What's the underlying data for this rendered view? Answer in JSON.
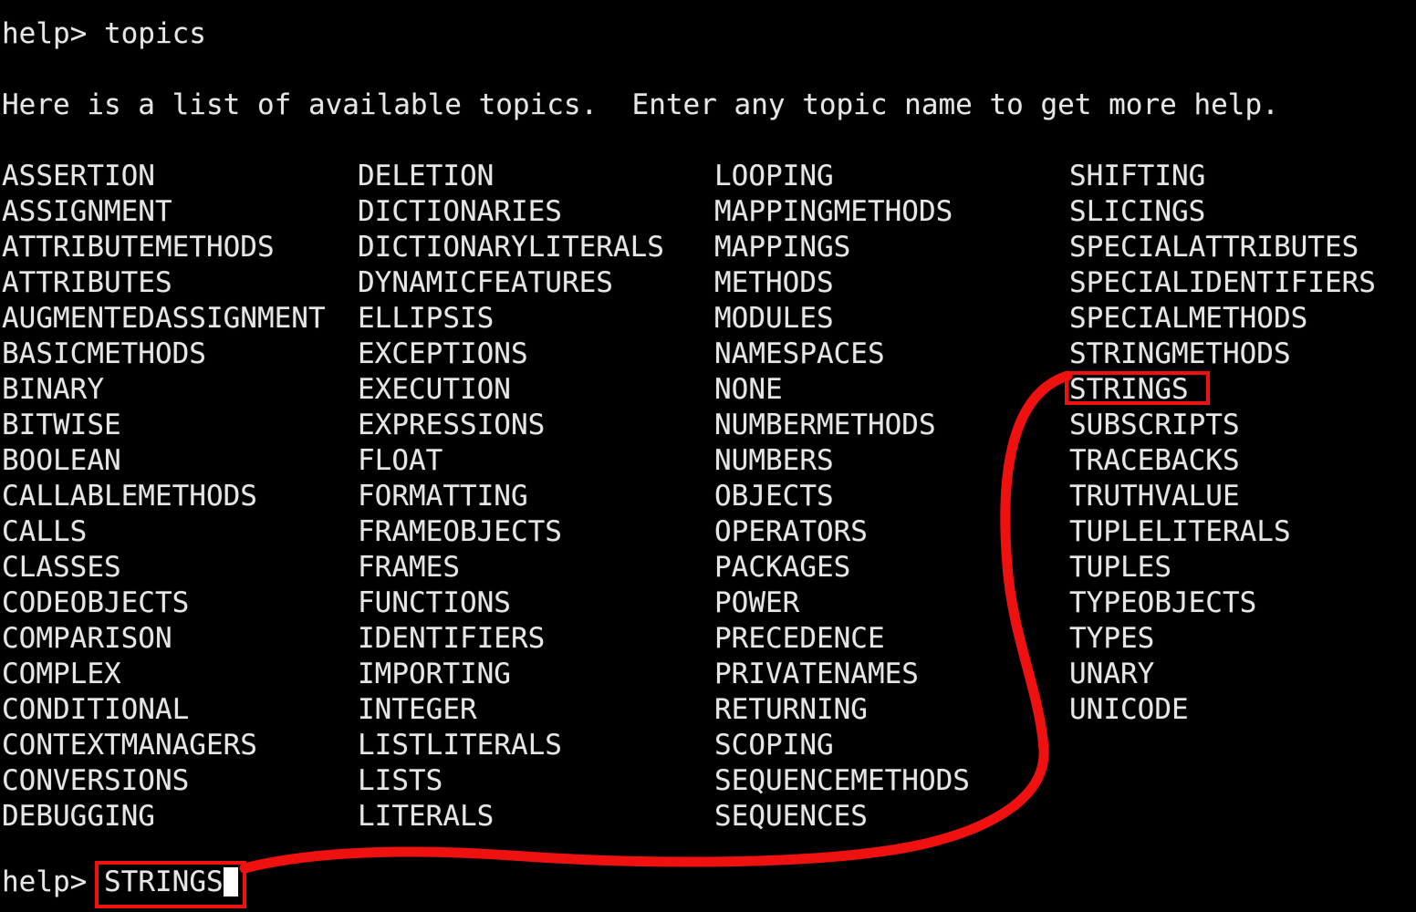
{
  "terminal": {
    "background_color": "#000000",
    "text_color": "#e6e6e6",
    "annotation_color": "#ef1010",
    "prompt_top": "help> topics",
    "intro_text": "Here is a list of available topics.  Enter any topic name to get more help.",
    "prompt_bottom_label": "help>",
    "entered_command": "STRINGS"
  },
  "topics": {
    "columns": [
      [
        "ASSERTION",
        "ASSIGNMENT",
        "ATTRIBUTEMETHODS",
        "ATTRIBUTES",
        "AUGMENTEDASSIGNMENT",
        "BASICMETHODS",
        "BINARY",
        "BITWISE",
        "BOOLEAN",
        "CALLABLEMETHODS",
        "CALLS",
        "CLASSES",
        "CODEOBJECTS",
        "COMPARISON",
        "COMPLEX",
        "CONDITIONAL",
        "CONTEXTMANAGERS",
        "CONVERSIONS",
        "DEBUGGING"
      ],
      [
        "DELETION",
        "DICTIONARIES",
        "DICTIONARYLITERALS",
        "DYNAMICFEATURES",
        "ELLIPSIS",
        "EXCEPTIONS",
        "EXECUTION",
        "EXPRESSIONS",
        "FLOAT",
        "FORMATTING",
        "FRAMEOBJECTS",
        "FRAMES",
        "FUNCTIONS",
        "IDENTIFIERS",
        "IMPORTING",
        "INTEGER",
        "LISTLITERALS",
        "LISTS",
        "LITERALS"
      ],
      [
        "LOOPING",
        "MAPPINGMETHODS",
        "MAPPINGS",
        "METHODS",
        "MODULES",
        "NAMESPACES",
        "NONE",
        "NUMBERMETHODS",
        "NUMBERS",
        "OBJECTS",
        "OPERATORS",
        "PACKAGES",
        "POWER",
        "PRECEDENCE",
        "PRIVATENAMES",
        "RETURNING",
        "SCOPING",
        "SEQUENCEMETHODS",
        "SEQUENCES"
      ],
      [
        "SHIFTING",
        "SLICINGS",
        "SPECIALATTRIBUTES",
        "SPECIALIDENTIFIERS",
        "SPECIALMETHODS",
        "STRINGMETHODS",
        "STRINGS",
        "SUBSCRIPTS",
        "TRACEBACKS",
        "TRUTHVALUE",
        "TUPLELITERALS",
        "TUPLES",
        "TYPEOBJECTS",
        "TYPES",
        "UNARY",
        "UNICODE"
      ]
    ]
  },
  "annotations": {
    "highlighted_topic": "STRINGS",
    "highlighted_input": "STRINGS",
    "arrow_description": "red curve linking the typed STRINGS command to the STRINGS entry in the topic list"
  }
}
